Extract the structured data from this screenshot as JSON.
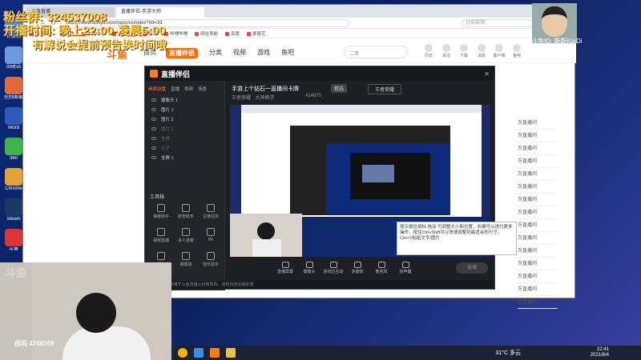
{
  "overlay": {
    "fans": "粉丝群: 324537008",
    "time": "开播时间: 晚上22:00-凌晨5:00",
    "notice": "有解说会提前预告换时间哦"
  },
  "desktop_icons": [
    {
      "label": "计算机",
      "color": "#4a8fe0",
      "icon": "computer-icon"
    },
    {
      "label": "回收站",
      "color": "#6c9ad8",
      "icon": "recycle-bin-icon"
    },
    {
      "label": "控制面板",
      "color": "#e06a3a",
      "icon": "control-panel-icon"
    },
    {
      "label": "Word",
      "color": "#2b5cb8",
      "icon": "word-icon"
    },
    {
      "label": "360",
      "color": "#3bb54a",
      "icon": "360-icon"
    },
    {
      "label": "Chrome",
      "color": "#e0a23a",
      "icon": "chrome-icon"
    },
    {
      "label": "Steam",
      "color": "#1b3a63",
      "icon": "steam-icon"
    },
    {
      "label": "斗鱼",
      "color": "#d33",
      "icon": "douyu-icon"
    }
  ],
  "browser": {
    "tabs": [
      "斗鱼直播",
      "直播伴侣-手游大师"
    ],
    "url": "https://www.douyu.com/topic/xximdex?rid=33",
    "bookmarks": [
      "网址大全",
      "斗鱼",
      "游戏中心",
      "小说大全",
      "影视",
      "哔哩哔哩",
      "网址导航",
      "百度",
      "爱奇艺"
    ],
    "search_placeholder": "比较影院"
  },
  "douyu": {
    "logo": "斗鱼",
    "nav": [
      "首页",
      "直播伴侣",
      "分类",
      "视频",
      "游戏",
      "鱼吧"
    ],
    "search_placeholder": "二哥",
    "icons": [
      {
        "label": "历史",
        "icon": "history-icon"
      },
      {
        "label": "关注",
        "icon": "follow-icon"
      },
      {
        "label": "下载",
        "icon": "download-icon"
      },
      {
        "label": "消息",
        "icon": "message-icon"
      },
      {
        "label": "客户端",
        "icon": "client-icon"
      },
      {
        "label": "鱼吧",
        "icon": "yuba-icon"
      }
    ],
    "side_items": [
      "万直播间",
      "万直播间",
      "万直播间",
      "万直播间",
      "万直播间",
      "万直播间",
      "万直播间",
      "万直播间",
      "万直播间",
      "万直播间",
      "万直播间",
      "万直播间",
      "万直播间",
      "万直播间",
      "万直播间"
    ]
  },
  "app": {
    "title": "直播伴侣",
    "tabs": [
      "画面设置",
      "直播",
      "视频",
      "场景"
    ],
    "layers": [
      {
        "label": "摄像头 1",
        "dim": false
      },
      {
        "label": "图片 1",
        "dim": false
      },
      {
        "label": "图片 2",
        "dim": false
      },
      {
        "label": "图片 1",
        "dim": true
      },
      {
        "label": "全屏",
        "dim": true
      },
      {
        "label": "文字",
        "dim": true
      },
      {
        "label": "全屏 1",
        "dim": false
      }
    ],
    "tools_title": "工具箱",
    "tools": [
      "弹幕助手",
      "房管助手",
      "主播任务",
      "视频直播",
      "多人连麦",
      "PK",
      "直播助手",
      "弹幕墙",
      "音乐助手"
    ],
    "subheader": {
      "title": "手游上个钻石一直播间卡牌",
      "tag": "精选",
      "type": "王者荣耀",
      "viewers": "414870",
      "category": "王者荣耀 · 大神教学"
    },
    "bottom_buttons": [
      "直播屏幕",
      "摄像头",
      "多机位互动",
      "多媒体",
      "麦克风",
      "扬声器"
    ],
    "go_live": "直播",
    "status": "正在直播 · 请遵守斗鱼直播公约和规则，违规内容会被处理"
  },
  "tooltip": "提示按住鼠标 拖动 可调整大小和位置，右键可以进行更多操作，按住Ctrl+Shift可以快速调整到最适合的尺寸，Ctrl+V粘贴文字/图片",
  "cam": {
    "watermark": "斗鱼",
    "room": "房间 4748769"
  },
  "streamer": {
    "id": "斗鱼ID: 斯斯KaiDi"
  },
  "taskbar": {
    "weather": "31°C 多云",
    "time": "22:41",
    "date": "2021/8/4"
  }
}
